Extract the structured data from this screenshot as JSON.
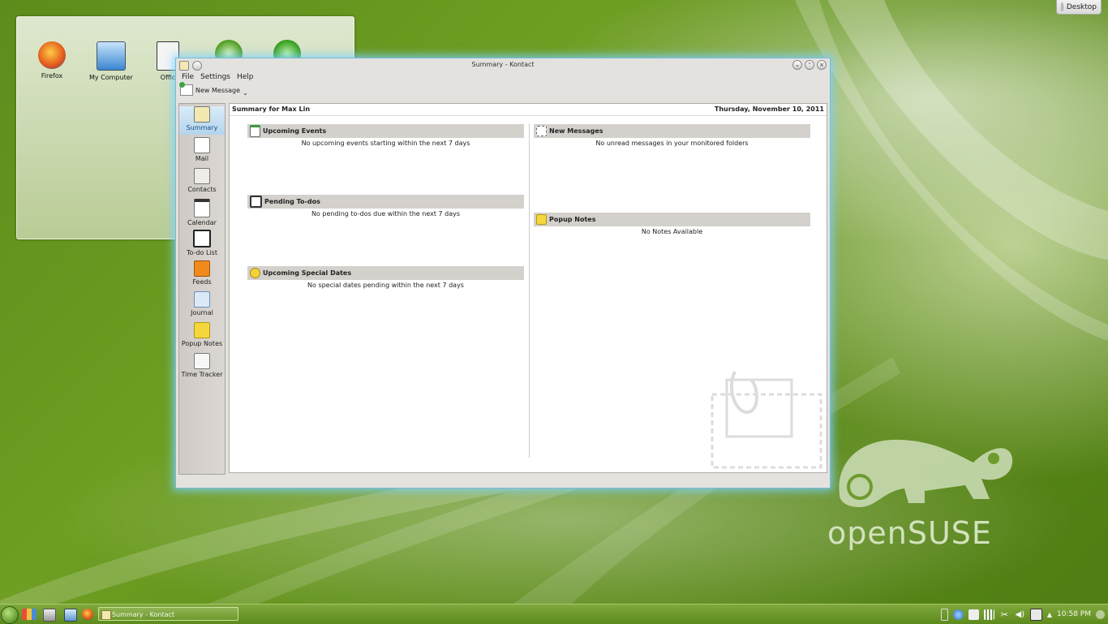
{
  "desktop": {
    "button_label": "Desktop",
    "icons": [
      {
        "label": "Firefox"
      },
      {
        "label": "My Computer"
      },
      {
        "label": "Offic"
      },
      {
        "label": ""
      },
      {
        "label": ""
      }
    ],
    "logo_text": "openSUSE"
  },
  "window": {
    "title": "Summary - Kontact",
    "menu": [
      "File",
      "Settings",
      "Help"
    ],
    "toolbar": {
      "new_message_label": "New Message"
    },
    "sidebar": [
      {
        "label": "Summary",
        "icon": "summary-icon"
      },
      {
        "label": "Mail",
        "icon": "mail-icon"
      },
      {
        "label": "Contacts",
        "icon": "contacts-icon"
      },
      {
        "label": "Calendar",
        "icon": "calendar-icon"
      },
      {
        "label": "To-do List",
        "icon": "todo-icon"
      },
      {
        "label": "Feeds",
        "icon": "feeds-icon"
      },
      {
        "label": "Journal",
        "icon": "journal-icon"
      },
      {
        "label": "Popup Notes",
        "icon": "notes-icon"
      },
      {
        "label": "Time Tracker",
        "icon": "timetracker-icon"
      }
    ],
    "summary": {
      "title": "Summary for Max Lin",
      "date": "Thursday, November 10, 2011",
      "sections": {
        "events": {
          "title": "Upcoming Events",
          "message": "No upcoming events starting within the next 7 days"
        },
        "todos": {
          "title": "Pending To-dos",
          "message": "No pending to-dos due within the next 7 days"
        },
        "special": {
          "title": "Upcoming Special Dates",
          "message": "No special dates pending within the next 7 days"
        },
        "messages": {
          "title": "New Messages",
          "message": "No unread messages in your monitored folders"
        },
        "notes": {
          "title": "Popup Notes",
          "message": "No Notes Available"
        }
      }
    }
  },
  "taskbar": {
    "task_label": "Summary - Kontact",
    "clock": "10:58 PM"
  },
  "colors": {
    "accent": "#7bb9d8",
    "wallpaper": "#5e8c1c"
  }
}
